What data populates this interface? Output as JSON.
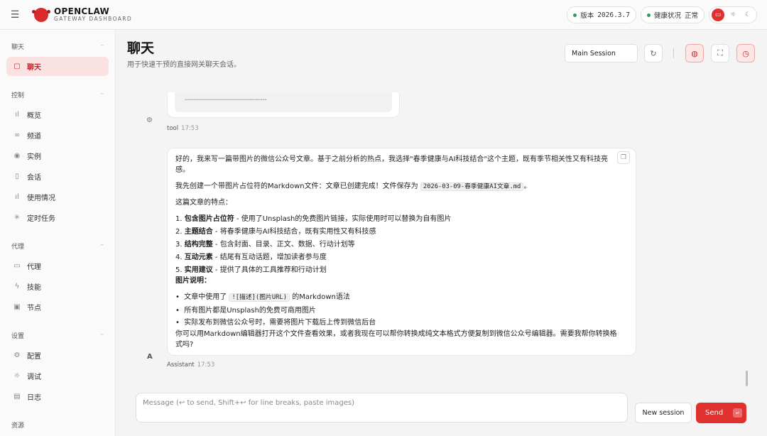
{
  "topbar": {
    "menu_icon": "hamburger-icon",
    "brand_title": "OPENCLAW",
    "brand_subtitle": "GATEWAY DASHBOARD",
    "version_label": "版本",
    "version_value": "2026.3.7",
    "health_label": "健康状况",
    "health_value": "正常",
    "status_color": "#22a352",
    "accent_color": "#e0312f"
  },
  "sidebar": {
    "sections": [
      {
        "title": "聊天",
        "items": [
          {
            "label": "聊天",
            "icon": "chat-icon",
            "active": true
          }
        ]
      },
      {
        "title": "控制",
        "items": [
          {
            "label": "概览",
            "icon": "bar-chart-icon"
          },
          {
            "label": "频道",
            "icon": "link-icon"
          },
          {
            "label": "实例",
            "icon": "broadcast-icon"
          },
          {
            "label": "会话",
            "icon": "file-icon"
          },
          {
            "label": "使用情况",
            "icon": "bar-chart-icon"
          },
          {
            "label": "定时任务",
            "icon": "loader-icon"
          }
        ]
      },
      {
        "title": "代理",
        "items": [
          {
            "label": "代理",
            "icon": "folder-icon"
          },
          {
            "label": "技能",
            "icon": "lightning-icon"
          },
          {
            "label": "节点",
            "icon": "monitor-icon"
          }
        ]
      },
      {
        "title": "设置",
        "items": [
          {
            "label": "配置",
            "icon": "gear-icon"
          },
          {
            "label": "调试",
            "icon": "bug-icon"
          },
          {
            "label": "日志",
            "icon": "log-icon"
          }
        ]
      },
      {
        "title": "资源",
        "items": []
      }
    ]
  },
  "header": {
    "title": "聊天",
    "subtitle": "用于快速干预的直接网关聊天会话。",
    "session_select": "Main Session"
  },
  "chat": {
    "previous": {
      "role": "tool",
      "time": "17:53",
      "code_fragment": "………………………………………………………………"
    },
    "assistant": {
      "role": "Assistant",
      "time": "17:53",
      "avatar": "A",
      "line1": "好的，我来写一篇带图片的微信公众号文章。基于之前分析的热点，我选择\"春季健康与AI科技结合\"这个主题，既有季节相关性又有科技亮",
      "line1b": "感。",
      "line2_pre": "我先创建一个带图片占位符的Markdown文件：文章已创建完成！文件保存为 ",
      "line2_code": "2026-03-09-春季健康AI文章.md",
      "line2_post": "。",
      "features_title": "这篇文章的特点：",
      "features": [
        {
          "n": "1.",
          "bold": "包含图片占位符",
          "rest": " - 使用了Unsplash的免费图片链接，实际使用时可以替换为自有图片"
        },
        {
          "n": "2.",
          "bold": "主题结合",
          "rest": " - 将春季健康与AI科技结合，既有实用性又有科技感"
        },
        {
          "n": "3.",
          "bold": "结构完整",
          "rest": " - 包含封面、目录、正文、数据、行动计划等"
        },
        {
          "n": "4.",
          "bold": "互动元素",
          "rest": " - 结尾有互动话题，增加读者参与度"
        },
        {
          "n": "5.",
          "bold": "实用建议",
          "rest": " - 提供了具体的工具推荐和行动计划"
        }
      ],
      "image_title": "图片说明：",
      "bullet1_pre": "文章中使用了 ",
      "bullet1_code": "![描述](图片URL)",
      "bullet1_post": " 的Markdown语法",
      "bullet2": "所有图片都是Unsplash的免费可商用图片",
      "bullet3": "实际发布到微信公众号时，需要将图片下载后上传到微信后台",
      "closing1": "你可以用Markdown编辑器打开这个文件查看效果，或者我现在可以帮你转换成纯文本格式方便复制到微信公众号编辑器。需要我帮你转换格",
      "closing2": "式吗?"
    }
  },
  "composer": {
    "placeholder": "Message (↩ to send, Shift+↩ for line breaks, paste images)",
    "new_session": "New session",
    "send": "Send"
  }
}
